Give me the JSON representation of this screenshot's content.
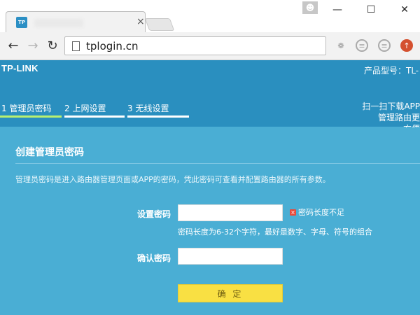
{
  "browser": {
    "tab_favicon": "TP",
    "tab_close": "×",
    "profile_icon": "person-icon",
    "minimize": "—",
    "maximize": "☐",
    "close": "✕",
    "url": "tplogin.cn",
    "extensions": [
      "kangaroo-icon",
      "circle-icon",
      "circle-icon",
      "upload-icon"
    ]
  },
  "router": {
    "brand": "TP-LINK",
    "model_label": "产品型号：TL-​",
    "steps": [
      {
        "label": "1 管理员密码",
        "active": true
      },
      {
        "label": "2 上网设置",
        "active": false
      },
      {
        "label": "3 无线设置",
        "active": false
      }
    ],
    "scan_text_line1": "扫一扫下载APP",
    "scan_text_line2": "管理路由更",
    "scan_text_line3": "方便",
    "section_title": "创建管理员密码",
    "description": "管理员密码是进入路由器管理页面或APP的密码，凭此密码可查看并配置路由器的所有参数。",
    "password_label": "设置密码",
    "password_value": "",
    "error_text": "密码长度不足",
    "hint_text": "密码长度为6-32个字符，最好是数字、字母、符号的组合",
    "confirm_label": "确认密码",
    "confirm_value": "",
    "submit_label": "确 定"
  },
  "colors": {
    "header_bg": "#2a8fbf",
    "page_bg": "#4aaed4",
    "active_step": "#b9f070",
    "button_bg": "#f9e043",
    "error_icon": "#e84a3a"
  }
}
